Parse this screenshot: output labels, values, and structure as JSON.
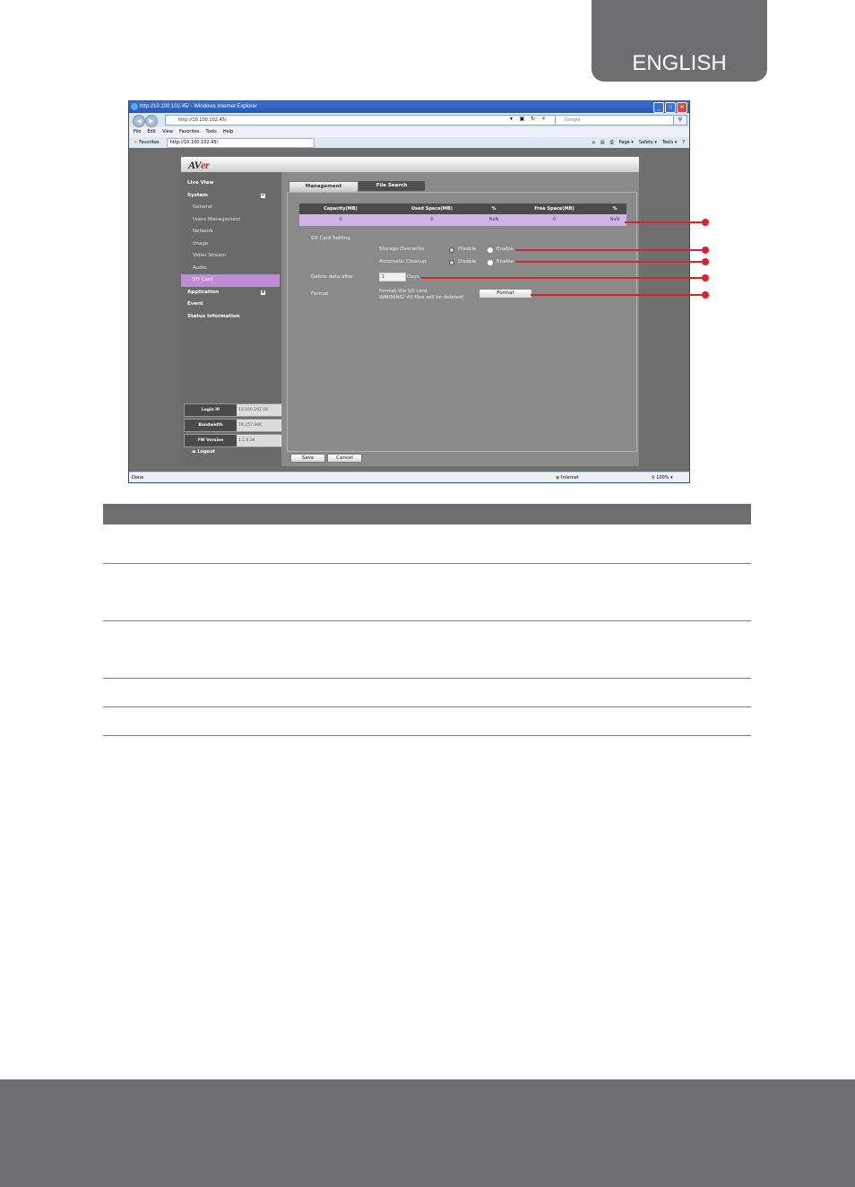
{
  "page": {
    "language_tab": "ENGLISH"
  },
  "browser": {
    "title": "http://10.100.102.45/ - Windows Internet Explorer",
    "url": "http://10.100.102.45/",
    "search_placeholder": "Google",
    "menu": [
      "File",
      "Edit",
      "View",
      "Favorites",
      "Tools",
      "Help"
    ],
    "favorites_label": "Favorites",
    "tab_title": "http://10.100.102.45/",
    "command_bar": [
      "Page ▾",
      "Safety ▾",
      "Tools ▾"
    ],
    "status_left": "Done",
    "status_zone": "Internet",
    "zoom": "100%"
  },
  "app": {
    "logo_prefix": "AV",
    "logo_suffix": "er",
    "sidebar": {
      "live_view": "Live View",
      "system": "System",
      "system_items": [
        "General",
        "Users Management",
        "Network",
        "Image",
        "Video Stream",
        "Audio",
        "SD Card"
      ],
      "active_item": "SD Card",
      "application": "Application",
      "event": "Event",
      "status_information": "Status Information",
      "login_ip_label": "Login IP",
      "login_ip_value": "10.100.102.59",
      "bandwidth_label": "Bandwidth",
      "bandwidth_value": "TX:257.66K",
      "fw_label": "FW Version",
      "fw_value": "1.1.0.34",
      "logout": "Logout"
    },
    "tabs": {
      "management": "Management",
      "file_search": "File Search"
    },
    "table": {
      "headers": [
        "Capacity(MB)",
        "Used Space(MB)",
        "%",
        "Free Space(MB)",
        "%"
      ],
      "row": [
        "0",
        "0",
        "NaN",
        "0",
        "NaN"
      ]
    },
    "sd_card_setting": "SD Card Setting",
    "storage_overwrite": "Storage Overwrite",
    "automatic_cleanup": "Automatic Cleanup",
    "disable": "Disable",
    "enable": "Enable",
    "delete_after": "Delete data after",
    "delete_value": "1",
    "days": "Days",
    "format_label": "Format",
    "format_note_1": "Format the SD card.",
    "format_note_2": "WARNING! All files will be deleted!",
    "format_button": "Format",
    "save": "Save",
    "cancel": "Cancel"
  },
  "colors": {
    "accent_gray": "#6d6e70",
    "highlight_purple": "#c08bd8",
    "callout_red": "#d5242c"
  }
}
